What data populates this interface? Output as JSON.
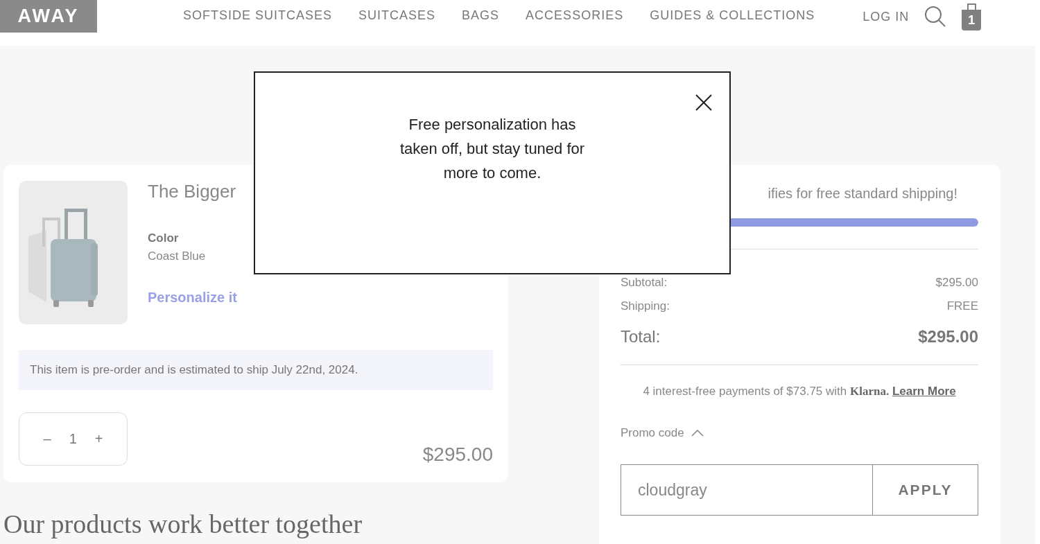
{
  "header": {
    "logo": "AWAY",
    "nav": [
      "SOFTSIDE SUITCASES",
      "SUITCASES",
      "BAGS",
      "ACCESSORIES",
      "GUIDES & COLLECTIONS"
    ],
    "login": "LOG IN",
    "cart_count": "1"
  },
  "cart_item": {
    "title": "The Bigger",
    "color_label": "Color",
    "color_value": "Coast Blue",
    "personalize": "Personalize it",
    "notice": "This item is pre-order and is estimated to ship July 22nd, 2024.",
    "decrement": "–",
    "quantity": "1",
    "increment": "+",
    "price": "$295.00"
  },
  "summary": {
    "shipping_message": "ifies for free standard shipping!",
    "shipping_progress": {
      "level": 1
    },
    "rows": [
      {
        "label": "Subtotal:",
        "value": "$295.00"
      },
      {
        "label": "Shipping:",
        "value": "FREE"
      }
    ],
    "total": {
      "label": "Total:",
      "value": "$295.00"
    },
    "klarna": {
      "text": "4 interest-free payments of $73.75 with",
      "brand": "Klarna.",
      "link": "Learn More"
    },
    "promo": {
      "label": "Promo code",
      "expanded": true,
      "value": "cloudgray",
      "button": "APPLY"
    }
  },
  "section_title": "Our products work better together",
  "modal": {
    "message": "Free personalization has taken off, but stay tuned for more to come."
  }
}
